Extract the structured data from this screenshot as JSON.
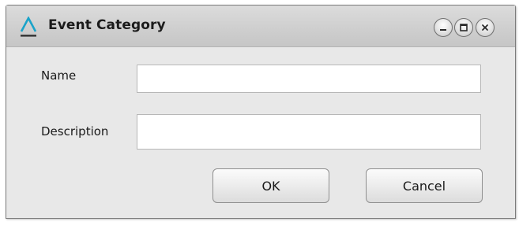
{
  "window": {
    "title": "Event Category",
    "app_icon": "delta-logo-icon",
    "accent_color": "#1aa3c9",
    "controls": {
      "minimize_icon": "minimize-icon",
      "maximize_icon": "maximize-icon",
      "close_icon": "close-icon"
    }
  },
  "form": {
    "name_label": "Name",
    "name_value": "",
    "description_label": "Description",
    "description_value": ""
  },
  "buttons": {
    "ok_label": "OK",
    "cancel_label": "Cancel"
  }
}
